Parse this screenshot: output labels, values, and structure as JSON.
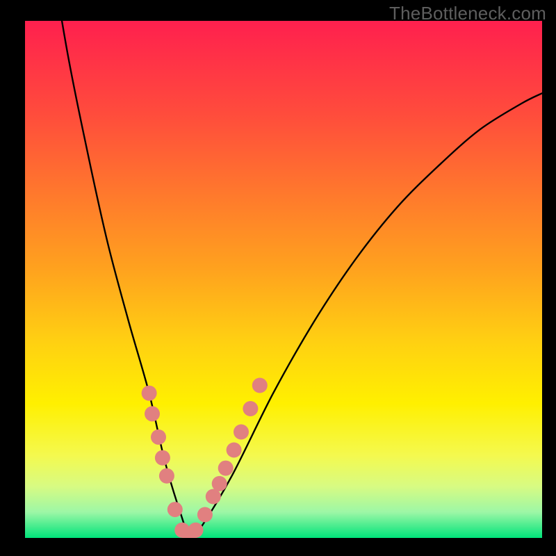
{
  "watermark": "TheBottleneck.com",
  "chart_data": {
    "type": "line",
    "title": "",
    "xlabel": "",
    "ylabel": "",
    "xlim": [
      0,
      100
    ],
    "ylim": [
      0,
      100
    ],
    "gradient_colors_top_to_bottom": [
      "#ff204e",
      "#ff4c3c",
      "#ff7a2c",
      "#ffa21e",
      "#ffd012",
      "#fff000",
      "#e8f840",
      "#b8f98a",
      "#00e37a"
    ],
    "series": [
      {
        "name": "curve",
        "x": [
          0,
          4,
          8,
          12,
          16,
          20,
          24,
          27,
          30,
          32,
          34,
          40,
          48,
          56,
          64,
          72,
          80,
          88,
          96,
          100
        ],
        "values": [
          150,
          120,
          95,
          75,
          57,
          42,
          28,
          15,
          5,
          0,
          2,
          12,
          28,
          42,
          54,
          64,
          72,
          79,
          84,
          86
        ]
      }
    ],
    "markers": {
      "name": "highlight-dots",
      "color": "#e18080",
      "x": [
        24.0,
        24.6,
        25.8,
        26.6,
        27.4,
        29.0,
        30.4,
        31.8,
        33.0,
        34.8,
        36.4,
        37.6,
        38.8,
        40.4,
        41.8,
        43.6,
        45.4
      ],
      "y": [
        28.0,
        24.0,
        19.5,
        15.5,
        12.0,
        5.5,
        1.5,
        0.5,
        1.5,
        4.5,
        8.0,
        10.5,
        13.5,
        17.0,
        20.5,
        25.0,
        29.5
      ]
    }
  }
}
